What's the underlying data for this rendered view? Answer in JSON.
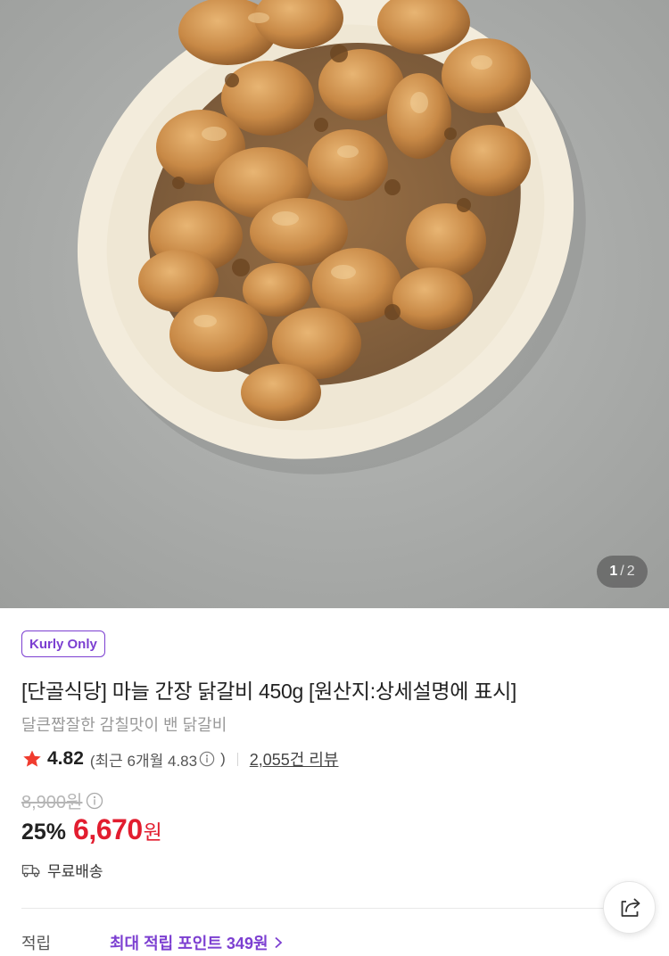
{
  "gallery": {
    "image_alt": "마늘 간장 닭갈비",
    "current_page": "1",
    "separator": "/",
    "total_pages": "2"
  },
  "product": {
    "badge": "Kurly Only",
    "title": "[단골식당] 마늘 간장 닭갈비 450g [원산지:상세설명에 표시]",
    "subtitle": "달큰짭잘한 감칠맛이 밴 닭갈비",
    "rating": "4.82",
    "recent_prefix": "(최근 6개월 4.83",
    "recent_suffix": ")",
    "review_count": "2,055건 리뷰",
    "original_price": "8,900원",
    "discount_rate": "25%",
    "price": "6,670",
    "currency": "원",
    "delivery": "무료배송",
    "points_label": "적립",
    "points_value": "최대 적립 포인트 349원"
  },
  "colors": {
    "brand_purple": "#7c3fd1",
    "price_red": "#e21d2f",
    "star_red": "#f03b2e"
  },
  "icons": {
    "star": "star-icon",
    "info": "info-icon",
    "truck": "truck-icon",
    "chevron": "chevron-right-icon",
    "share": "share-icon"
  }
}
